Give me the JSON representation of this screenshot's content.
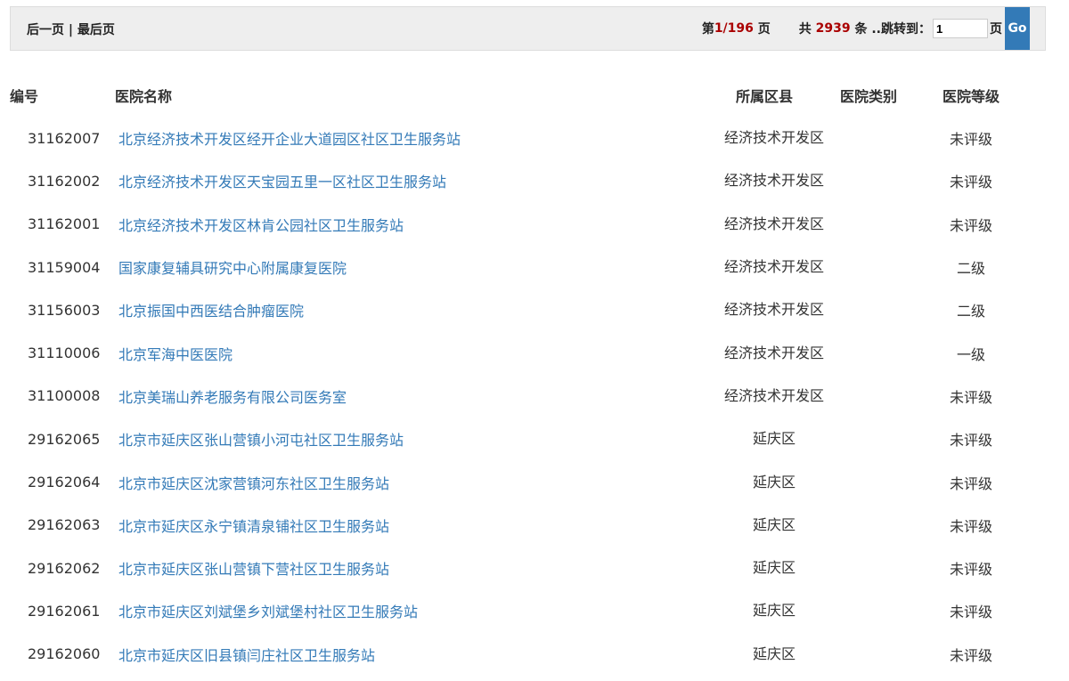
{
  "pager": {
    "prev": "后一页",
    "sep": "|",
    "last": "最后页",
    "page_prefix": "第",
    "page_current": "1/196",
    "page_suffix": "页",
    "total_prefix": "共",
    "total": "2939",
    "total_suffix": "条 ..跳转到：",
    "jump_value": "1",
    "jump_suffix": "页",
    "go": "Go"
  },
  "headers": {
    "id": "编号",
    "name": "医院名称",
    "district": "所属区县",
    "type": "医院类别",
    "grade": "医院等级"
  },
  "rows": [
    {
      "id": "31162007",
      "name": "北京经济技术开发区经开企业大道园区社区卫生服务站",
      "district": "经济技术开发区",
      "type": "",
      "grade": "未评级"
    },
    {
      "id": "31162002",
      "name": "北京经济技术开发区天宝园五里一区社区卫生服务站",
      "district": "经济技术开发区",
      "type": "",
      "grade": "未评级"
    },
    {
      "id": "31162001",
      "name": "北京经济技术开发区林肯公园社区卫生服务站",
      "district": "经济技术开发区",
      "type": "",
      "grade": "未评级"
    },
    {
      "id": "31159004",
      "name": "国家康复辅具研究中心附属康复医院",
      "district": "经济技术开发区",
      "type": "",
      "grade": "二级"
    },
    {
      "id": "31156003",
      "name": "北京振国中西医结合肿瘤医院",
      "district": "经济技术开发区",
      "type": "",
      "grade": "二级"
    },
    {
      "id": "31110006",
      "name": "北京军海中医医院",
      "district": "经济技术开发区",
      "type": "",
      "grade": "一级"
    },
    {
      "id": "31100008",
      "name": "北京美瑞山养老服务有限公司医务室",
      "district": "经济技术开发区",
      "type": "",
      "grade": "未评级"
    },
    {
      "id": "29162065",
      "name": "北京市延庆区张山营镇小河屯社区卫生服务站",
      "district": "延庆区",
      "type": "",
      "grade": "未评级"
    },
    {
      "id": "29162064",
      "name": "北京市延庆区沈家营镇河东社区卫生服务站",
      "district": "延庆区",
      "type": "",
      "grade": "未评级"
    },
    {
      "id": "29162063",
      "name": "北京市延庆区永宁镇清泉铺社区卫生服务站",
      "district": "延庆区",
      "type": "",
      "grade": "未评级"
    },
    {
      "id": "29162062",
      "name": "北京市延庆区张山营镇下营社区卫生服务站",
      "district": "延庆区",
      "type": "",
      "grade": "未评级"
    },
    {
      "id": "29162061",
      "name": "北京市延庆区刘斌堡乡刘斌堡村社区卫生服务站",
      "district": "延庆区",
      "type": "",
      "grade": "未评级"
    },
    {
      "id": "29162060",
      "name": "北京市延庆区旧县镇闫庄社区卫生服务站",
      "district": "延庆区",
      "type": "",
      "grade": "未评级"
    }
  ]
}
